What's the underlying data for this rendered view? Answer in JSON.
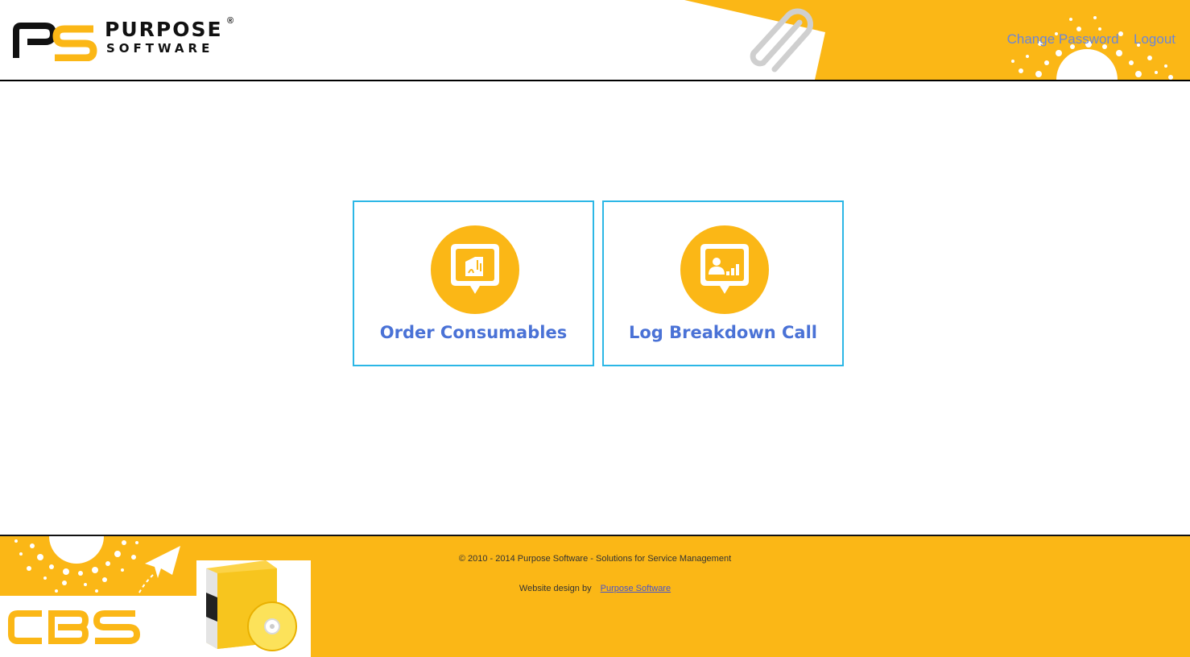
{
  "brand": {
    "name": "PURPOSE",
    "tagline": "SOFTWARE",
    "registered": "®",
    "colors": {
      "accent": "#fbb716",
      "link": "#6a86d9",
      "tile_border": "#2cb7e6",
      "tile_text": "#4a72d6"
    }
  },
  "header": {
    "links": {
      "change_password": "Change Password",
      "logout": "Logout"
    }
  },
  "tiles": [
    {
      "label": "Order Consumables",
      "icon": "printer-chat-icon"
    },
    {
      "label": "Log Breakdown Call",
      "icon": "user-signal-chat-icon"
    }
  ],
  "footer": {
    "copyright": "© 2010 - 2014 Purpose Software - Solutions for Service Management",
    "design_prefix": "Website design by",
    "design_link": "Purpose Software",
    "product_logo": "CBS"
  }
}
